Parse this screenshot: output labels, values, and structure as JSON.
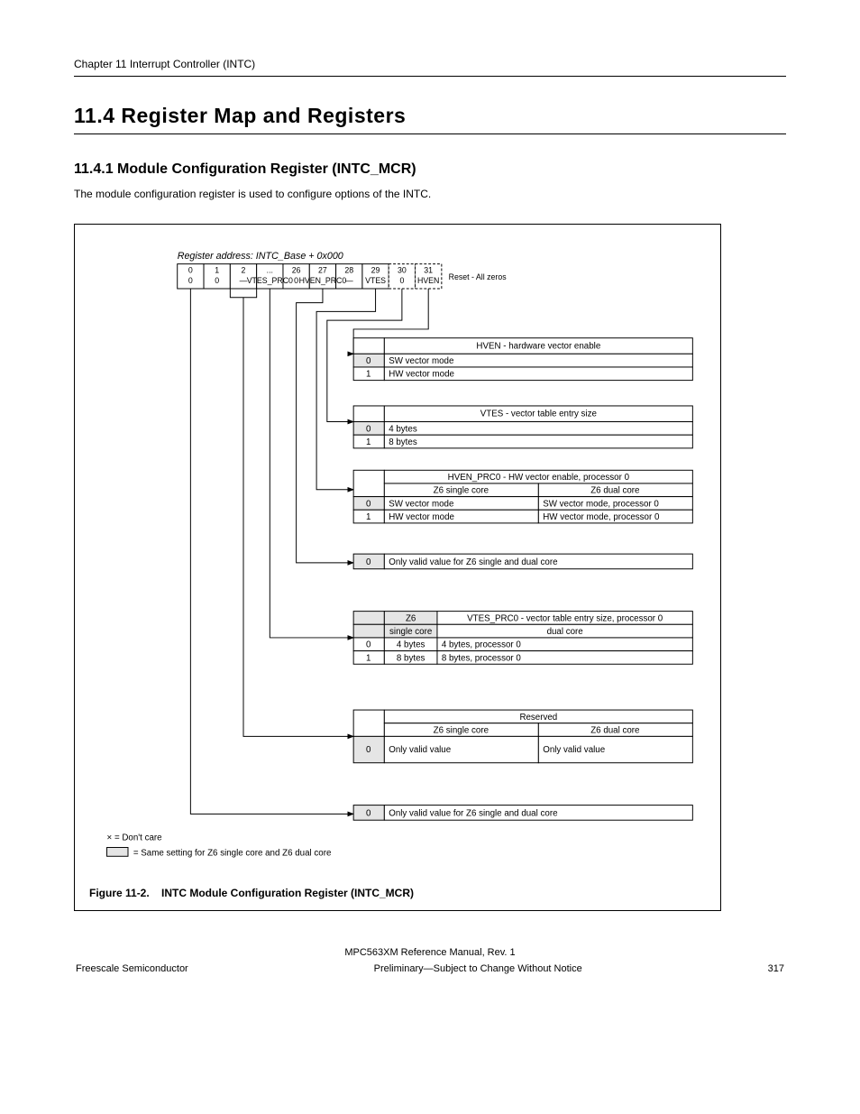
{
  "chapter": "Chapter 11 Interrupt Controller (INTC)",
  "section_title": "11.4 Register Map and Registers",
  "subsection_title": "11.4.1 Module Configuration Register (INTC_MCR)",
  "intro": "The module configuration register is used to configure options of the INTC.",
  "figure": {
    "number": "Figure 11-2.",
    "title": "INTC Module Configuration Register (INTC_MCR)"
  },
  "register": {
    "label": "Register address: INTC_Base + 0x000",
    "top_bits": [
      "0",
      "1",
      "2",
      "...",
      "26",
      "27",
      "28",
      "29",
      "30",
      "31"
    ],
    "fields": [
      "0",
      "0",
      "—",
      "VTES_PRC0",
      "0",
      "HVEN_PRC0",
      "—",
      "VTES",
      "0",
      "HVEN"
    ],
    "reset": "Reset - All zeros"
  },
  "tables": {
    "hven": {
      "header": "HVEN - hardware vector enable",
      "rows": [
        {
          "v": "0",
          "d": "SW vector mode"
        },
        {
          "v": "1",
          "d": "HW vector mode"
        }
      ]
    },
    "vtes": {
      "header": "VTES - vector table entry size",
      "rows": [
        {
          "v": "0",
          "d": "4 bytes"
        },
        {
          "v": "1",
          "d": "8 bytes"
        }
      ]
    },
    "hven_prc0": {
      "header": "HVEN_PRC0 - HW vector enable, processor 0",
      "sub": {
        "l": "Z6 single core",
        "r": "Z6 dual core"
      },
      "rows": [
        {
          "v": "0",
          "d": "SW vector mode",
          "d2": "SW vector mode, processor 0"
        },
        {
          "v": "1",
          "d": "HW vector mode",
          "d2": "HW vector mode, processor 0"
        }
      ]
    },
    "bit28": {
      "rows": [
        {
          "v": "0",
          "d": "Only valid value for Z6 single and dual core"
        }
      ]
    },
    "vtes_prc0": {
      "header": "VTES_PRC0 - vector table entry size, processor 0",
      "subhead": {
        "a": "Z6",
        "b": "single core",
        "c": "dual core"
      },
      "rows": [
        {
          "v": "0",
          "d1": "4 bytes",
          "d2": "4 bytes, processor 0"
        },
        {
          "v": "1",
          "d1": "8 bytes",
          "d2": "8 bytes, processor 0"
        }
      ]
    },
    "reserved": {
      "header": "Reserved",
      "sub": {
        "l": "Z6 single core",
        "r": "Z6 dual core"
      },
      "rows": [
        {
          "v": "0",
          "d1": "Only valid value",
          "d2": "Only valid value"
        }
      ]
    },
    "bit0": {
      "rows": [
        {
          "v": "0",
          "d": "Only valid value for Z6 single and dual core"
        }
      ]
    }
  },
  "notes": {
    "n1": "× = Don't care",
    "n2": "= Same setting for Z6 single core and Z6 dual core"
  },
  "footer": {
    "left": "MPC563XM Reference Manual, Rev. 1",
    "mid": "Freescale Semiconductor",
    "right": "Preliminary—Subject to Change Without Notice",
    "page": "317"
  }
}
